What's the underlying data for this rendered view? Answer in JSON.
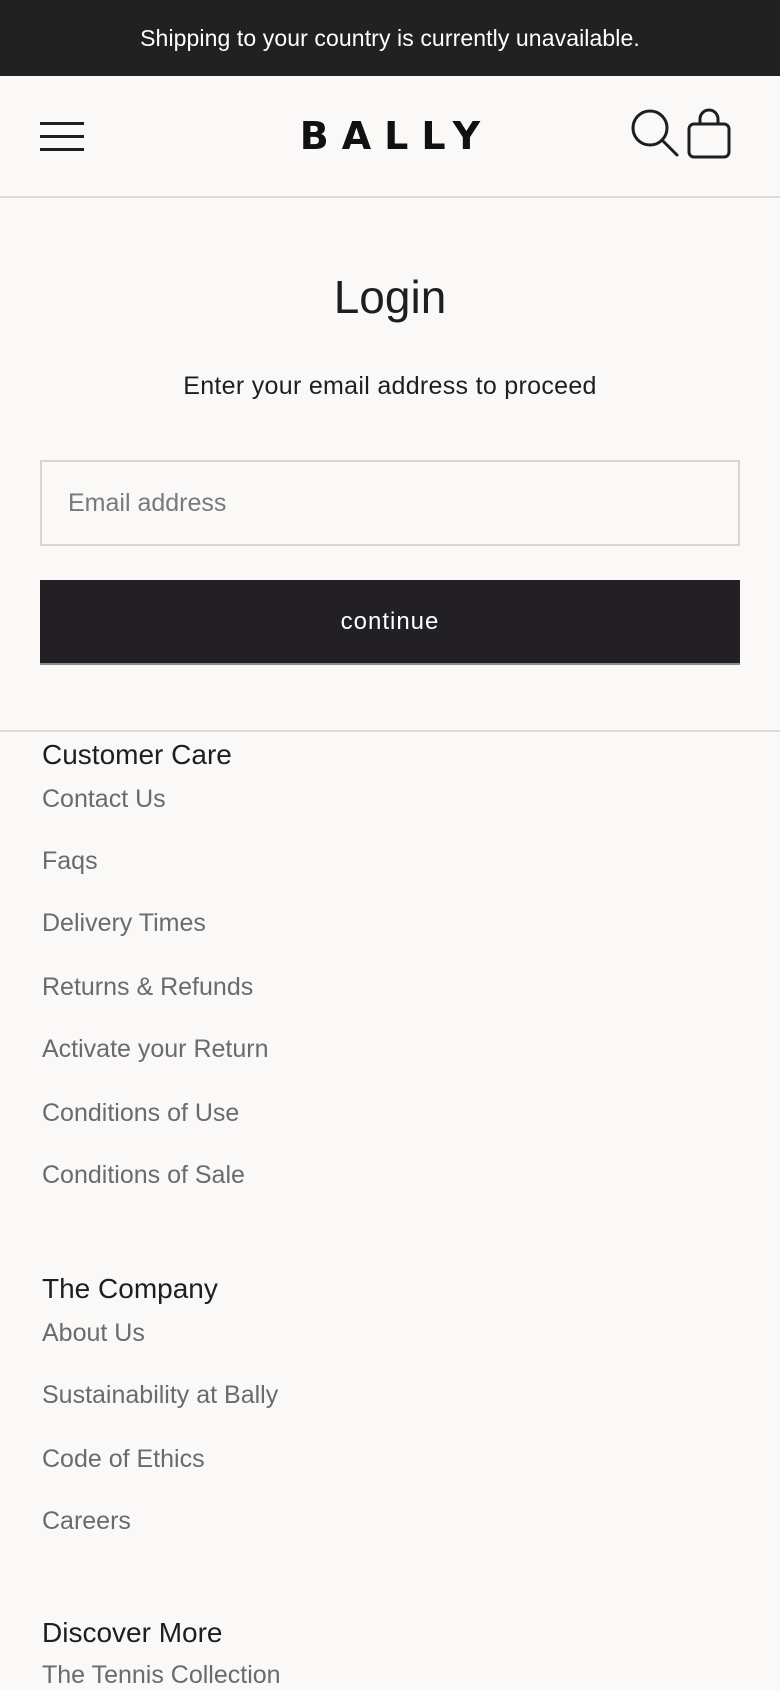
{
  "banner": {
    "text": "Shipping to your country is currently unavailable."
  },
  "header": {
    "brand": "BALLY",
    "icons": {
      "menu": "hamburger-menu-icon",
      "search": "search-icon",
      "bag": "shopping-bag-icon"
    }
  },
  "login": {
    "title": "Login",
    "subtitle": "Enter your email address to proceed",
    "email_placeholder": "Email address",
    "continue_label": "continue"
  },
  "footer": {
    "customer_care": {
      "heading": "Customer Care",
      "links": [
        "Contact Us",
        "Faqs",
        "Delivery Times",
        "Returns & Refunds",
        "Activate your Return",
        "Conditions of Use",
        "Conditions of Sale"
      ]
    },
    "company": {
      "heading": "The Company",
      "links": [
        "About Us",
        "Sustainability at Bally",
        "Code of Ethics",
        "Careers"
      ]
    },
    "discover": {
      "heading": "Discover More",
      "links": [
        "The Tennis Collection"
      ]
    }
  }
}
